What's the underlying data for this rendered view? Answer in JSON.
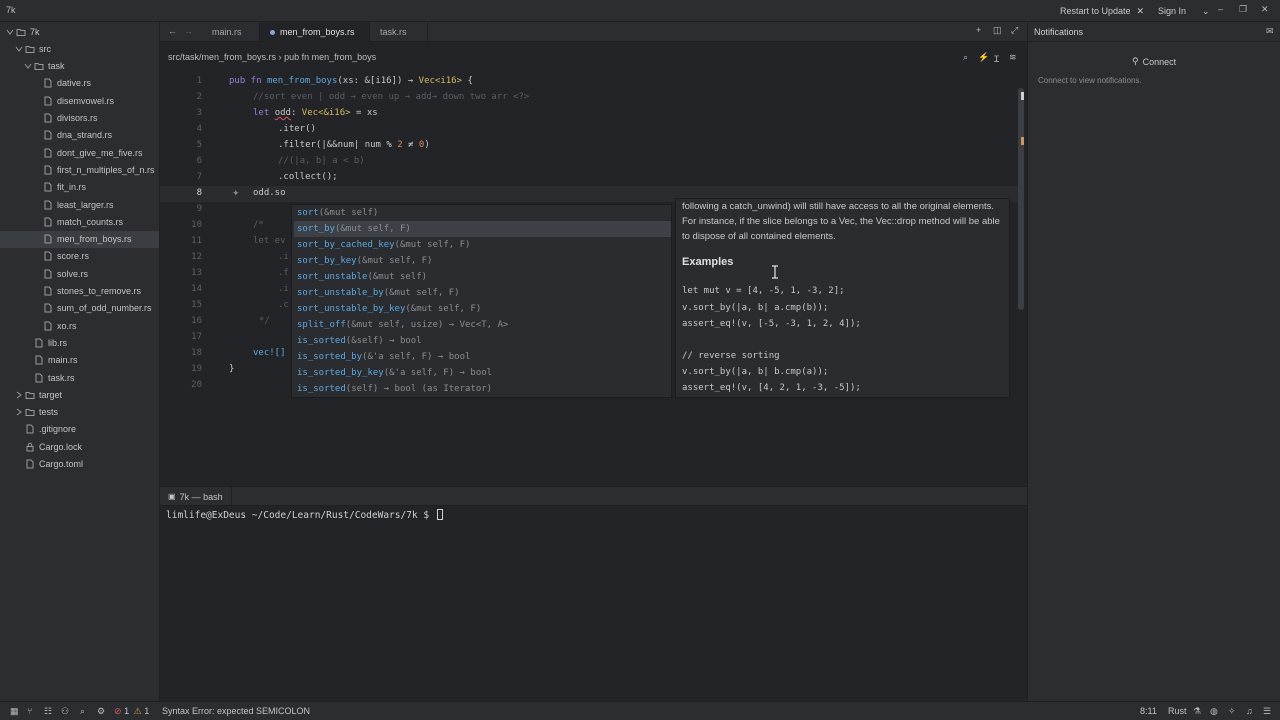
{
  "titlebar": {
    "app_title": "7k",
    "restart_label": "Restart to Update",
    "signin_label": "Sign In"
  },
  "project": {
    "items": [
      {
        "label": "7k",
        "depth": 0,
        "kind": "folder-open"
      },
      {
        "label": "src",
        "depth": 1,
        "kind": "folder-open"
      },
      {
        "label": "task",
        "depth": 2,
        "kind": "folder-open"
      },
      {
        "label": "dative.rs",
        "depth": 3,
        "kind": "file"
      },
      {
        "label": "disemvowel.rs",
        "depth": 3,
        "kind": "file"
      },
      {
        "label": "divisors.rs",
        "depth": 3,
        "kind": "file"
      },
      {
        "label": "dna_strand.rs",
        "depth": 3,
        "kind": "file"
      },
      {
        "label": "dont_give_me_five.rs",
        "depth": 3,
        "kind": "file"
      },
      {
        "label": "first_n_multiples_of_n.rs",
        "depth": 3,
        "kind": "file"
      },
      {
        "label": "fit_in.rs",
        "depth": 3,
        "kind": "file"
      },
      {
        "label": "least_larger.rs",
        "depth": 3,
        "kind": "file"
      },
      {
        "label": "match_counts.rs",
        "depth": 3,
        "kind": "file"
      },
      {
        "label": "men_from_boys.rs",
        "depth": 3,
        "kind": "file",
        "selected": true
      },
      {
        "label": "score.rs",
        "depth": 3,
        "kind": "file"
      },
      {
        "label": "solve.rs",
        "depth": 3,
        "kind": "file"
      },
      {
        "label": "stones_to_remove.rs",
        "depth": 3,
        "kind": "file"
      },
      {
        "label": "sum_of_odd_number.rs",
        "depth": 3,
        "kind": "file"
      },
      {
        "label": "xo.rs",
        "depth": 3,
        "kind": "file"
      },
      {
        "label": "lib.rs",
        "depth": 2,
        "kind": "file"
      },
      {
        "label": "main.rs",
        "depth": 2,
        "kind": "file"
      },
      {
        "label": "task.rs",
        "depth": 2,
        "kind": "file"
      },
      {
        "label": "target",
        "depth": 1,
        "kind": "folder"
      },
      {
        "label": "tests",
        "depth": 1,
        "kind": "folder"
      },
      {
        "label": ".gitignore",
        "depth": 1,
        "kind": "file"
      },
      {
        "label": "Cargo.lock",
        "depth": 1,
        "kind": "lock"
      },
      {
        "label": "Cargo.toml",
        "depth": 1,
        "kind": "file"
      }
    ]
  },
  "tabs": [
    {
      "label": "main.rs",
      "active": false
    },
    {
      "label": "men_from_boys.rs",
      "active": true
    },
    {
      "label": "task.rs",
      "active": false
    }
  ],
  "breadcrumb": {
    "path": "src/task/men_from_boys.rs",
    "separator": "›",
    "symbol": "pub fn men_from_boys"
  },
  "editor": {
    "current_line": 8,
    "lines": [
      {
        "n": "1",
        "text": ""
      },
      {
        "n": "2",
        "text": ""
      },
      {
        "n": "3",
        "text": ""
      },
      {
        "n": "4",
        "text": ""
      },
      {
        "n": "5",
        "text": ""
      },
      {
        "n": "6",
        "text": ""
      },
      {
        "n": "7",
        "text": ""
      },
      {
        "n": "8",
        "text": ""
      },
      {
        "n": "9",
        "text": ""
      },
      {
        "n": "10",
        "text": ""
      },
      {
        "n": "11",
        "text": ""
      },
      {
        "n": "12",
        "text": ""
      },
      {
        "n": "13",
        "text": ""
      },
      {
        "n": "14",
        "text": ""
      },
      {
        "n": "15",
        "text": ""
      },
      {
        "n": "16",
        "text": ""
      },
      {
        "n": "17",
        "text": ""
      },
      {
        "n": "18",
        "text": ""
      },
      {
        "n": "19",
        "text": ""
      },
      {
        "n": "20",
        "text": ""
      }
    ],
    "code": {
      "l1_kw1": "pub fn ",
      "l1_fn": "men_from_boys",
      "l1_rest": "(xs: &[i16]) → ",
      "l1_ty": "Vec<i16>",
      "l1_end": " {",
      "l2": "//sort even | odd → even up → add→ down two arr <?>",
      "l3_kw": "let ",
      "l3_var": "odd",
      "l3_mid": ": ",
      "l3_ty": "Vec<&i16>",
      "l3_end": " = xs",
      "l4": ".iter()",
      "l5_a": ".filter(|&&num| num % ",
      "l5_n1": "2",
      "l5_b": " ≠ ",
      "l5_n2": "0",
      "l5_c": ")",
      "l6": "//(|a, b| a < b)",
      "l7": ".collect();",
      "l8": "odd.so",
      "l10": "/*",
      "l11": "let ev",
      "l12": ".i",
      "l13": ".f",
      "l14": ".i",
      "l15": ".c",
      "l16": "*/",
      "l18": "vec![]",
      "l19": "}"
    }
  },
  "completion": {
    "items": [
      {
        "name": "sort",
        "sig": "(&mut self)",
        "selected": false
      },
      {
        "name": "sort_by",
        "sig": "(&mut self, F)",
        "selected": true
      },
      {
        "name": "sort_by_cached_key",
        "sig": "(&mut self, F)",
        "selected": false
      },
      {
        "name": "sort_by_key",
        "sig": "(&mut self, F)",
        "selected": false
      },
      {
        "name": "sort_unstable",
        "sig": "(&mut self)",
        "selected": false
      },
      {
        "name": "sort_unstable_by",
        "sig": "(&mut self, F)",
        "selected": false
      },
      {
        "name": "sort_unstable_by_key",
        "sig": "(&mut self, F)",
        "selected": false
      },
      {
        "name": "split_off",
        "sig": "(&mut self, usize) → Vec<T, A>",
        "selected": false
      },
      {
        "name": "is_sorted",
        "sig": "(&self) → bool",
        "selected": false
      },
      {
        "name": "is_sorted_by",
        "sig": "(&'a self, F) → bool",
        "selected": false
      },
      {
        "name": "is_sorted_by_key",
        "sig": "(&'a self, F) → bool",
        "selected": false
      },
      {
        "name": "is_sorted",
        "sig": "(self) → bool (as Iterator)",
        "selected": false
      }
    ]
  },
  "docs": {
    "para1": "following a catch_unwind) will still have access to all the original elements. For instance, if the slice belongs to a Vec, the Vec::drop method will be able to dispose of all contained elements.",
    "heading": "Examples",
    "code1": "let mut v = [4, -5, 1, -3, 2];",
    "code2": "v.sort_by(|a, b| a.cmp(b));",
    "code3": "assert_eq!(v, [-5, -3, 1, 2, 4]);",
    "code4": "// reverse sorting",
    "code5": "v.sort_by(|a, b| b.cmp(a));",
    "code6": "assert_eq!(v, [4, 2, 1, -3, -5]);"
  },
  "terminal": {
    "tab_label": "7k — bash",
    "prompt": "limlife@ExDeus ~/Code/Learn/Rust/CodeWars/7k $ "
  },
  "notifications": {
    "title": "Notifications",
    "connect_label": "Connect",
    "hint": "Connect to view notifications."
  },
  "statusbar": {
    "errors": "1",
    "warnings": "1",
    "message": "Syntax Error: expected SEMICOLON",
    "position": "8:11",
    "language": "Rust"
  },
  "colors": {
    "keyword": "#9b7dd9",
    "function": "#5fa8e0",
    "type": "#d9b95f",
    "number": "#e08855",
    "comment": "#5a5d63",
    "error": "#e05561"
  }
}
